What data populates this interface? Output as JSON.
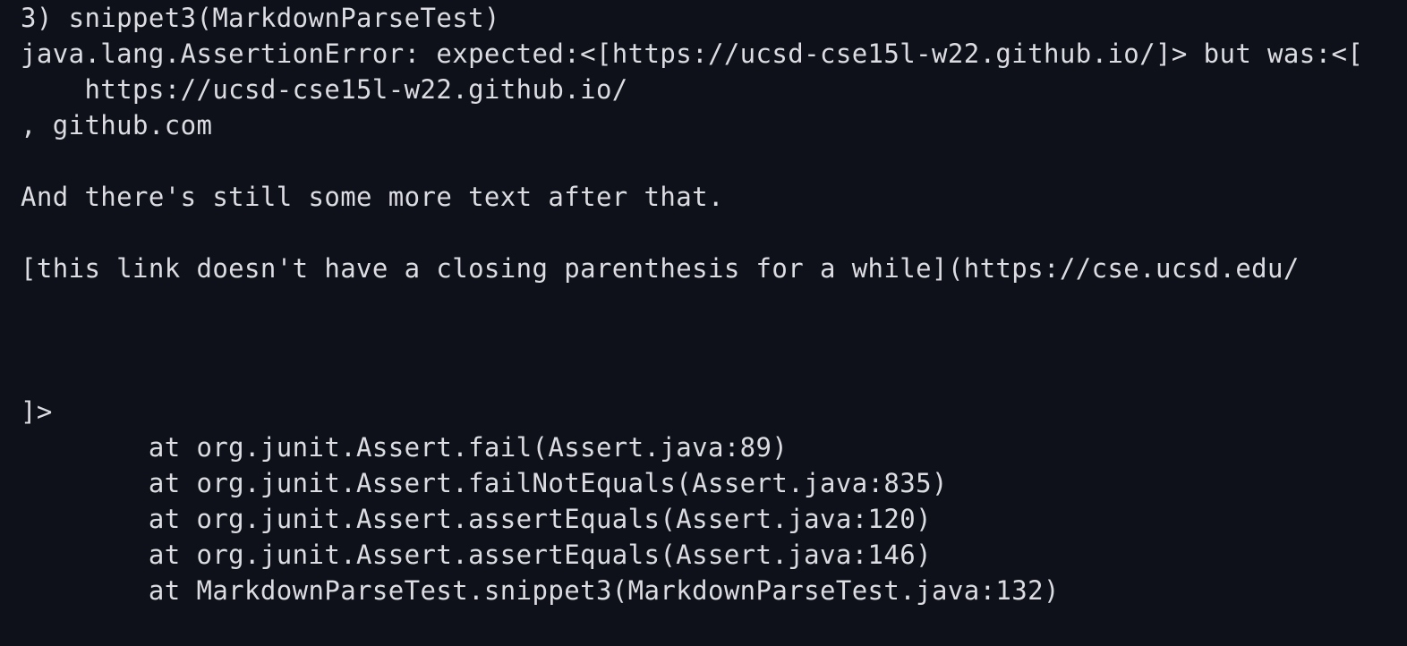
{
  "terminal": {
    "background": "#0f111a",
    "foreground": "#dcdde3",
    "lines": [
      "3) snippet3(MarkdownParseTest)",
      "java.lang.AssertionError: expected:<[https://ucsd-cse15l-w22.github.io/]> but was:<[",
      "    https://ucsd-cse15l-w22.github.io/",
      ", github.com",
      "",
      "And there's still some more text after that.",
      "",
      "[this link doesn't have a closing parenthesis for a while](https://cse.ucsd.edu/",
      "",
      "",
      "",
      "]>",
      "        at org.junit.Assert.fail(Assert.java:89)",
      "        at org.junit.Assert.failNotEquals(Assert.java:835)",
      "        at org.junit.Assert.assertEquals(Assert.java:120)",
      "        at org.junit.Assert.assertEquals(Assert.java:146)",
      "        at MarkdownParseTest.snippet3(MarkdownParseTest.java:132)"
    ]
  }
}
